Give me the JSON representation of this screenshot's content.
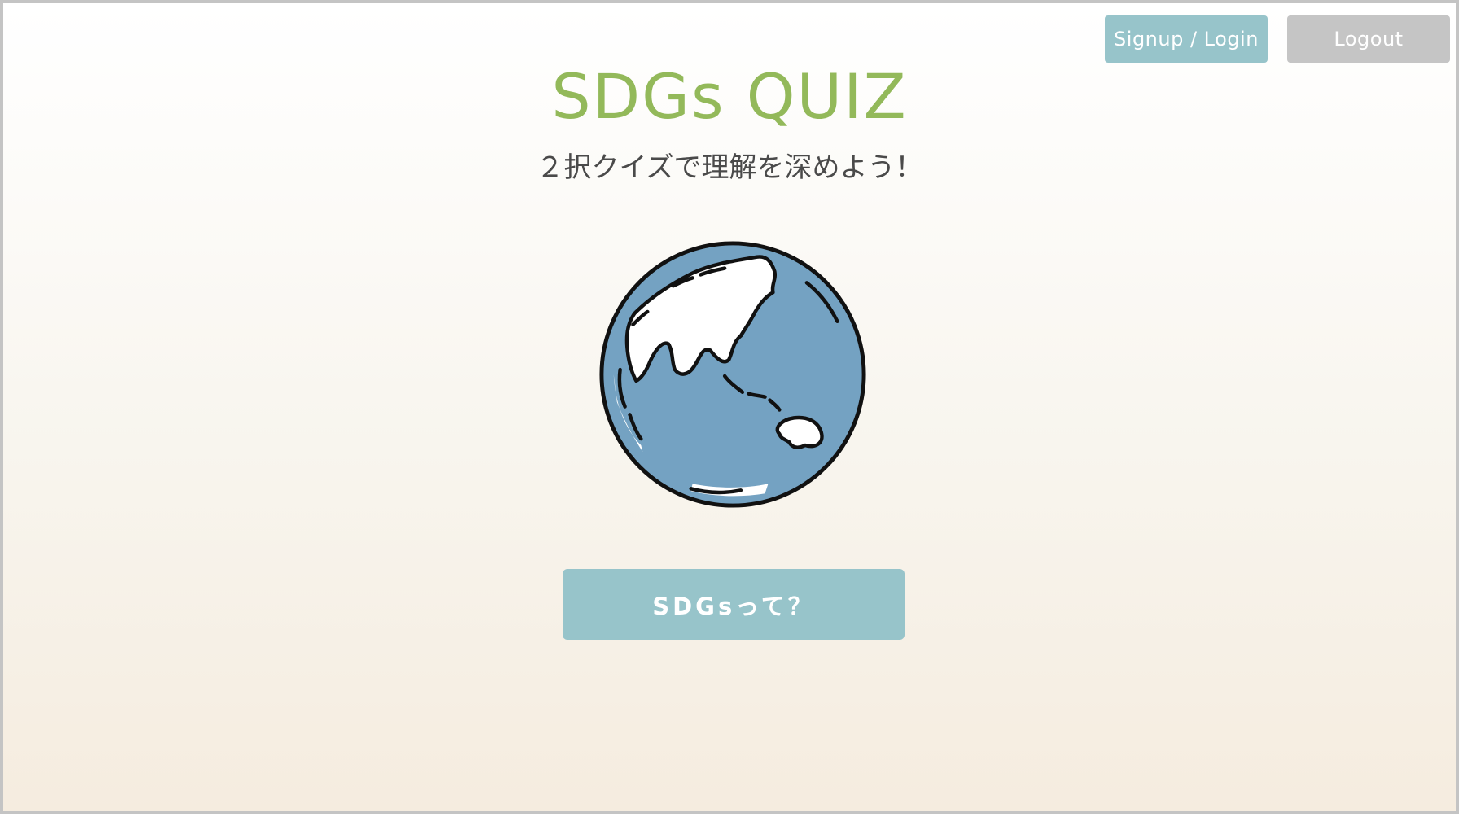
{
  "header": {
    "signup_login_label": "Signup / Login",
    "logout_label": "Logout"
  },
  "hero": {
    "title": "SDGs QUIZ",
    "subtitle": "２択クイズで理解を深めよう！",
    "image_icon": "globe-icon"
  },
  "main": {
    "about_button_label": "SDGsって？"
  },
  "colors": {
    "accent_green": "#93b95a",
    "button_teal": "#97c4ca",
    "button_gray": "#c5c5c5",
    "ocean_blue": "#74a2c2",
    "land_white": "#ffffff",
    "outline": "#111111"
  }
}
